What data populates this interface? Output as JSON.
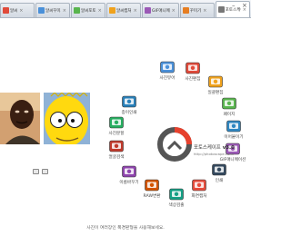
{
  "tabs": [
    {
      "label": "알씨",
      "color": "#e04a3a"
    },
    {
      "label": "알씨꾸미기",
      "color": "#4a90d9"
    },
    {
      "label": "알씨포토",
      "color": "#59b54e"
    },
    {
      "label": "알씨캡처",
      "color": "#f0a21c"
    },
    {
      "label": "GIF애니메이션",
      "color": "#9b59b6"
    },
    {
      "label": "꾸미기",
      "color": "#e67e22"
    },
    {
      "label": "포토스케이프",
      "color": "#777777"
    }
  ],
  "window_controls": {
    "minimize": "–",
    "close": "×"
  },
  "menu": [
    {
      "label": "사진뷰어",
      "color": "#4a90d9"
    },
    {
      "label": "사진편집",
      "color": "#e04a3a"
    },
    {
      "label": "일괄편집",
      "color": "#f0a21c"
    },
    {
      "label": "페이지",
      "color": "#59b54e"
    },
    {
      "label": "이어붙이기",
      "color": "#2e86c1"
    },
    {
      "label": "GIF애니메이션",
      "color": "#9b59b6"
    },
    {
      "label": "인쇄",
      "color": "#34495e"
    },
    {
      "label": "화면캡처",
      "color": "#e74c3c"
    },
    {
      "label": "색상검출",
      "color": "#16a085"
    },
    {
      "label": "RAW변환",
      "color": "#d35400"
    },
    {
      "label": "이름바꾸기",
      "color": "#8e44ad"
    },
    {
      "label": "얼굴검색",
      "color": "#c0392b"
    },
    {
      "label": "사진분할",
      "color": "#27ae60"
    },
    {
      "label": "종이인쇄",
      "color": "#2980b9"
    }
  ],
  "brand": {
    "name": "포토스케이프",
    "version": "v3.0",
    "url": "http://photoscape.co.kr"
  },
  "hint": "사진이 여러장인 폭경판형을 사용해보세요."
}
